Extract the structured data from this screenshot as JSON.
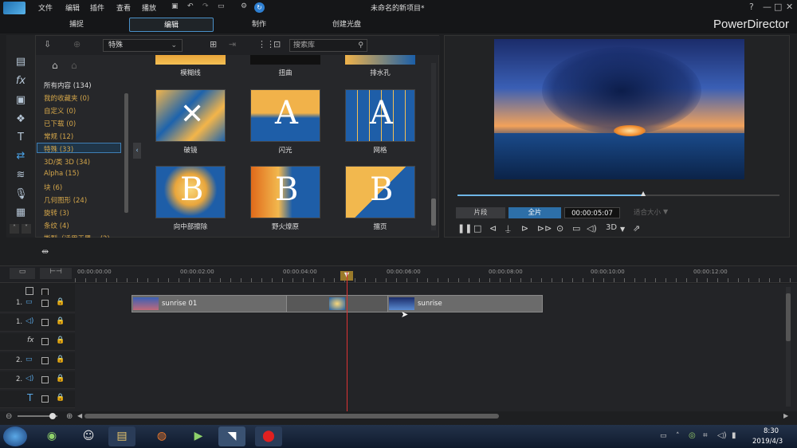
{
  "menubar": {
    "items": [
      "文件",
      "编辑",
      "插件",
      "查看",
      "播放"
    ],
    "title": "未命名的新项目*",
    "help": "?",
    "min": "—",
    "max": "□",
    "close": "✕"
  },
  "modes": {
    "capture": "捕捉",
    "edit": "编辑",
    "produce": "制作",
    "disc": "创建光盘",
    "brand": "PowerDirector"
  },
  "library": {
    "category_select": "特殊",
    "search_placeholder": "搜索库",
    "categories": [
      "所有内容 (134)",
      "我的收藏夹 (0)",
      "自定义 (0)",
      "已下载 (0)",
      "常规 (12)",
      "特殊 (33)",
      "3D/类 3D (34)",
      "Alpha (15)",
      "块 (6)",
      "几何图形 (24)",
      "旋转 (3)",
      "条纹 (4)",
      "撕裂（适用于黑… (2)"
    ],
    "top_labels": [
      "模糊线",
      "扭曲",
      "排水孔"
    ],
    "mid_labels": [
      "破镜",
      "闪光",
      "网格"
    ],
    "bottom_labels": [
      "向中部擦除",
      "野火燎原",
      "擂页"
    ],
    "mid_letters": [
      "",
      "A",
      "A"
    ],
    "bottom_letters": [
      "B",
      "B",
      "B"
    ]
  },
  "preview": {
    "clip_tab": "片段",
    "movie_tab": "全片",
    "timecode": "00:00:05:07",
    "fit": "适合大小",
    "mode3d": "3D",
    "progress": 0.58
  },
  "timeline": {
    "ticks": [
      "00:00:00:00",
      "00:00:02:00",
      "00:00:04:00",
      "00:00:06:00",
      "00:00:08:00",
      "00:00:10:00",
      "00:00:12:00"
    ],
    "tracks": [
      {
        "num": "",
        "icon": "□"
      },
      {
        "num": "1.",
        "icon": "▭"
      },
      {
        "num": "1.",
        "icon": "◁)"
      },
      {
        "num": "",
        "icon": "fx"
      },
      {
        "num": "2.",
        "icon": "▭"
      },
      {
        "num": "2.",
        "icon": "◁)"
      },
      {
        "num": "",
        "icon": "T"
      }
    ],
    "clip1": "sunrise 01",
    "clip2": "sunrise"
  },
  "taskbar": {
    "time": "8:30",
    "date": "2019/4/3"
  }
}
